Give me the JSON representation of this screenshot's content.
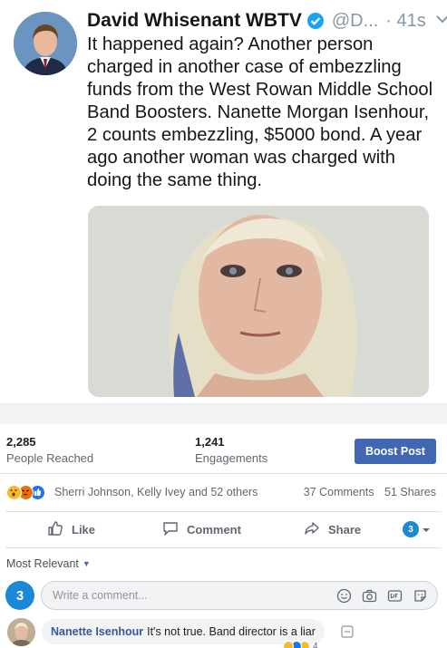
{
  "tweet": {
    "author_name": "David Whisenant WBTV",
    "handle": "@D...",
    "time": "· 41s",
    "text": "It happened again?  Another person charged in another case of embezzling funds from the West Rowan Middle School Band Boosters.  Nanette Morgan Isenhour, 2 counts embezzling, $5000 bond. A year ago another woman was charged with doing the same thing."
  },
  "stats": {
    "reached_value": "2,285",
    "reached_label": "People Reached",
    "engagements_value": "1,241",
    "engagements_label": "Engagements",
    "boost_label": "Boost Post"
  },
  "reactions": {
    "names": "Sherri Johnson, Kelly Ivey and 52 others",
    "comments": "37 Comments",
    "shares": "51 Shares"
  },
  "actions": {
    "like": "Like",
    "comment": "Comment",
    "share": "Share"
  },
  "comments": {
    "sort_label": "Most Relevant",
    "compose_placeholder": "Write a comment...",
    "page_avatar_text": "3",
    "first": {
      "author": "Nanette Isenhour",
      "text": "It's not true. Band director is a liar",
      "reaction_count": "4"
    }
  },
  "colors": {
    "brand_blue": "#4267b2",
    "link_blue": "#385898",
    "twitter_verified": "#1da1f2"
  }
}
